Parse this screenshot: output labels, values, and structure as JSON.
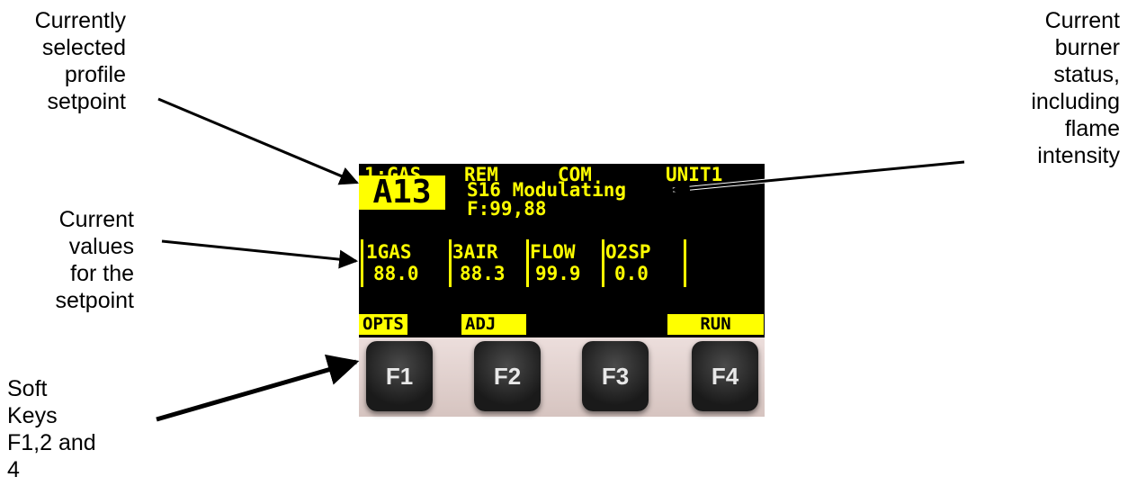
{
  "callouts": {
    "profile_setpoint": [
      "Currently",
      "selected",
      "profile",
      "setpoint"
    ],
    "current_values": [
      "Current",
      "values",
      "for the",
      "setpoint"
    ],
    "burner_status": [
      "Current",
      "burner",
      "status,",
      "including",
      "flame",
      "intensity"
    ],
    "soft_keys": [
      "Soft",
      "Keys",
      "F1,2 and",
      "4"
    ]
  },
  "display": {
    "status_row": [
      "1:GAS",
      "REM",
      "COM",
      "UNIT1"
    ],
    "profile": "A13",
    "burner_status": "S16 Modulating",
    "flame": "F:99,88",
    "channels": [
      {
        "name": "1GAS",
        "value": "88.0"
      },
      {
        "name": "3AIR",
        "value": "88.3"
      },
      {
        "name": "FLOW",
        "value": "99.9"
      },
      {
        "name": "O2SP",
        "value": "0.0"
      }
    ],
    "softkey_labels": [
      "OPTS",
      "ADJ",
      "RUN"
    ]
  },
  "keys": [
    "F1",
    "F2",
    "F3",
    "F4"
  ],
  "colors": {
    "lcd_background": "#000000",
    "lcd_text": "#ffff00",
    "key": "#2a2a2a",
    "keypad_bezel": "#e3d3d0"
  }
}
